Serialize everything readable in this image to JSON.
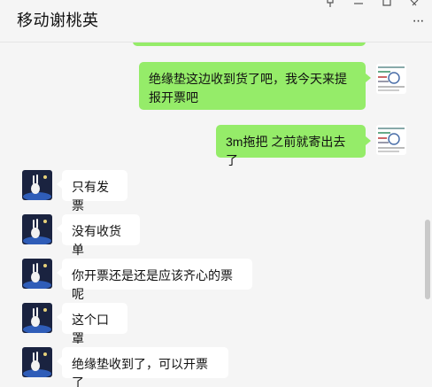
{
  "header": {
    "title": "移动谢桃英",
    "more_icon": "more-icon",
    "more_glyph": "···"
  },
  "messages": [
    {
      "side": "right",
      "text": "绝缘垫这边收到货了吧，我今天来提报开票吧",
      "avatar": "document-thumbnail-avatar"
    },
    {
      "side": "right",
      "text": "3m拖把 之前就寄出去了",
      "avatar": "document-thumbnail-avatar"
    },
    {
      "side": "left",
      "text": "只有发票",
      "avatar": "rabbit-avatar"
    },
    {
      "side": "left",
      "text": "没有收货单",
      "avatar": "rabbit-avatar"
    },
    {
      "side": "left",
      "text": "你开票还是还是应该齐心的票呢",
      "avatar": "rabbit-avatar"
    },
    {
      "side": "left",
      "text": "这个口罩",
      "avatar": "rabbit-avatar"
    },
    {
      "side": "left",
      "text": "绝缘垫收到了，可以开票了",
      "avatar": "rabbit-avatar"
    }
  ],
  "colors": {
    "self_bubble": "#95ec69",
    "other_bubble": "#ffffff",
    "background": "#f5f5f5"
  }
}
